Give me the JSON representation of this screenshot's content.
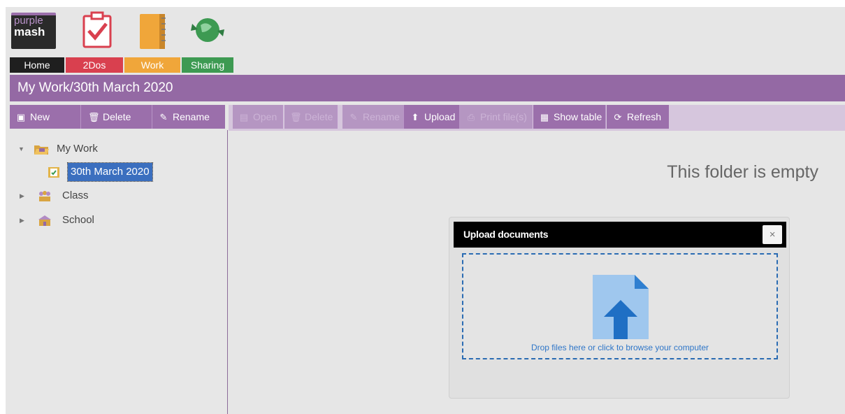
{
  "nav": {
    "home_label": "Home",
    "todos_label": "2Dos",
    "work_label": "Work",
    "sharing_label": "Sharing",
    "logo_text_top": "purple",
    "logo_text_bottom": "mash",
    "colors": {
      "home": "#1f1f1f",
      "todos": "#d9404f",
      "work": "#f0a63a",
      "sharing": "#3d9a52"
    }
  },
  "path": {
    "title": "My Work/30th March 2020"
  },
  "toolbar_left": {
    "new": "New",
    "delete": "Delete",
    "rename": "Rename"
  },
  "toolbar_right": {
    "open": "Open",
    "delete": "Delete",
    "rename": "Rename",
    "upload": "Upload",
    "print": "Print file(s)",
    "show_table": "Show table",
    "refresh": "Refresh"
  },
  "tree": {
    "my_work": "My Work",
    "selected_folder": "30th March 2020",
    "class": "Class",
    "school": "School"
  },
  "main": {
    "empty_message": "This folder is empty"
  },
  "upload_dialog": {
    "title": "Upload documents",
    "close": "×",
    "drop_text": "Drop files here or click to browse your computer"
  },
  "accent_color": "#9469a4"
}
